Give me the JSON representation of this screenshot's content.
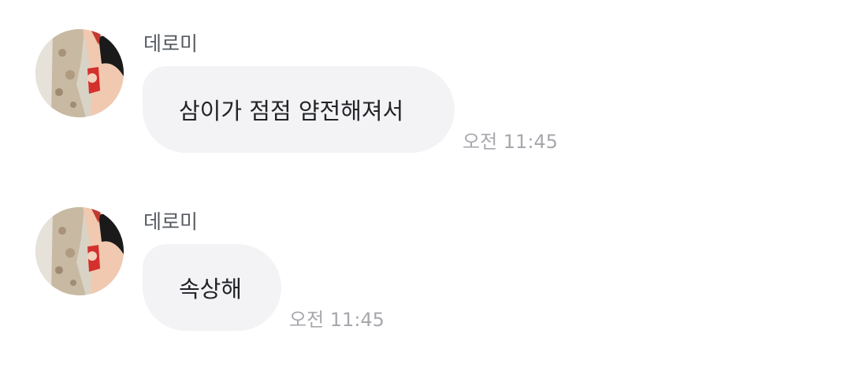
{
  "messages": [
    {
      "sender": "데로미",
      "text": "삼이가 점점 얌전해져서",
      "time": "오전 11:45"
    },
    {
      "sender": "데로미",
      "text": "속상해",
      "time": "오전 11:45"
    }
  ],
  "colors": {
    "bubble": "#f3f3f5",
    "text": "#222326",
    "sender": "#555a60",
    "time": "#a7a8ad",
    "background": "#ffffff"
  }
}
